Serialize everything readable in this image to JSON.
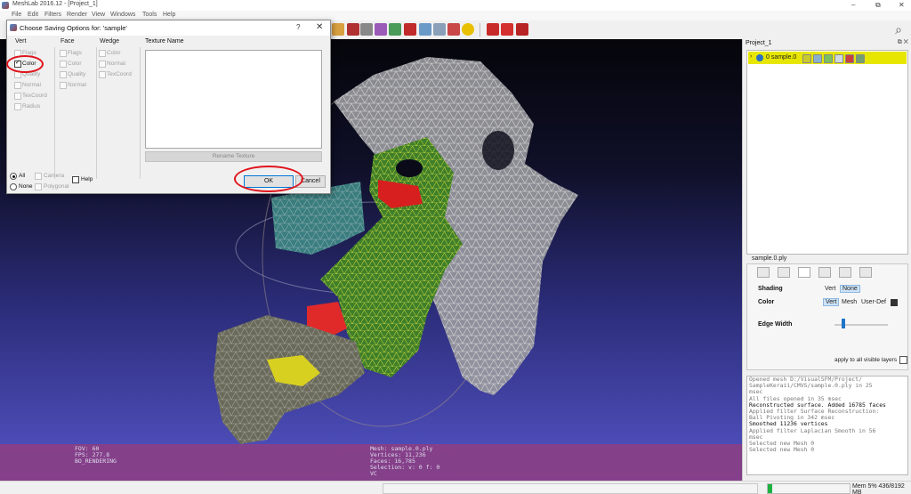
{
  "window": {
    "title": "MeshLab 2016.12 - [Project_1]",
    "minimize": "–",
    "maximize": "⧉",
    "close": "✕"
  },
  "menu": [
    "File",
    "Edit",
    "Filters",
    "Render",
    "View",
    "Windows",
    "Tools",
    "Help"
  ],
  "dialog": {
    "title": "Choose Saving Options for: 'sample'",
    "help_glyph": "?",
    "close_glyph": "✕",
    "vert": {
      "heading": "Vert",
      "options": [
        "Flags",
        "Color",
        "Quality",
        "Normal",
        "TexCoord",
        "Radius"
      ]
    },
    "face": {
      "heading": "Face",
      "options": [
        "Flags",
        "Color",
        "Quality",
        "Normal"
      ]
    },
    "wedge": {
      "heading": "Wedge",
      "options": [
        "Color",
        "Normal",
        "TexCoord"
      ]
    },
    "texture_name_label": "Texture Name",
    "rename_texture": "Rename Texture",
    "all_label": "All",
    "none_label": "None",
    "camera_label": "Camera",
    "polygonal_label": "Polygonal",
    "help_label": "Help",
    "ok_label": "OK",
    "cancel_label": "Cancel"
  },
  "viewport": {
    "info_left": [
      "FOV: 60",
      "FPS:  277.8",
      "BO_RENDERING"
    ],
    "info_center": [
      "Mesh: sample.0.ply",
      "Vertices: 11,236",
      "Faces: 16,785",
      "Selection: v: 0 f: 0",
      "VC"
    ]
  },
  "right_panel": {
    "project_title": "Project_1",
    "header_icons": "⧉ ✕",
    "layer": {
      "expand": "›",
      "name": "0  sample.0"
    },
    "file_label": "sample.0.ply",
    "shading_label": "Shading",
    "shading_vert": "Vert",
    "shading_none": "None",
    "color_label": "Color",
    "color_vert": "Vert",
    "color_mesh": "Mesh",
    "color_userdef": "User-Def",
    "edge_width_label": "Edge Width",
    "apply_label": "apply to all visible layers"
  },
  "log": [
    {
      "text": "Opened mesh D:/VisualSFM/Project/",
      "dark": false
    },
    {
      "text": "SampleKeraii/CMVS/sample.0.ply in 25",
      "dark": false
    },
    {
      "text": "msec",
      "dark": false
    },
    {
      "text": "All files opened in 35 msec",
      "dark": false
    },
    {
      "text": "Reconstructed surface. Added 16785 faces",
      "dark": true
    },
    {
      "text": "Applied filter Surface Reconstruction:",
      "dark": false
    },
    {
      "text": "Ball Pivoting in 342 msec",
      "dark": false
    },
    {
      "text": "Smoothed 11236 vertices",
      "dark": true
    },
    {
      "text": "Applied filter Laplacian Smooth in 56",
      "dark": false
    },
    {
      "text": "msec",
      "dark": false
    },
    {
      "text": "Selected new Mesh 0",
      "dark": false
    },
    {
      "text": "Selected new Mesh 0",
      "dark": false
    }
  ],
  "status": {
    "memory_label": "Mem 5% 436/8192 MB",
    "memory_fraction": 0.05
  },
  "colors": {
    "highlight_ring": "#e0141c",
    "layer_highlight": "#e6e600",
    "viewport_bottom": "#5454c6",
    "info_bar": "#8a3f86"
  }
}
